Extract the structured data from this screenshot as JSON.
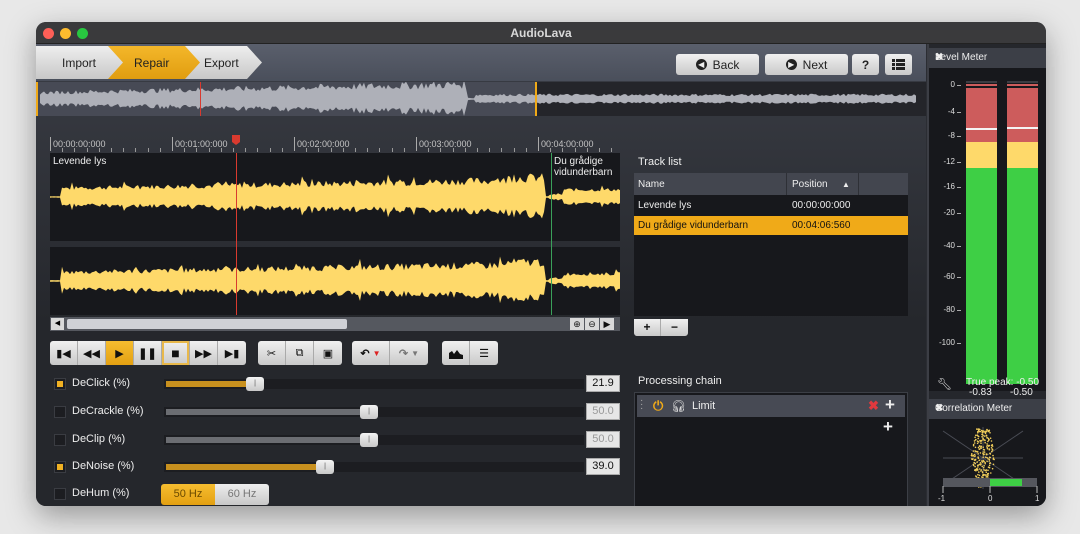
{
  "window": {
    "title": "AudioLava"
  },
  "breadcrumbs": [
    {
      "label": "Import",
      "active": false
    },
    {
      "label": "Repair",
      "active": true
    },
    {
      "label": "Export",
      "active": false
    }
  ],
  "nav": {
    "back_label": "Back",
    "next_label": "Next",
    "help_label": "?",
    "back_icon": "chevron-left-circle-icon",
    "next_icon": "chevron-right-circle-icon",
    "list_icon": "list-icon"
  },
  "timeline": {
    "ticks": [
      "00:00:00:000",
      "00:01:00:000",
      "00:02:00:000",
      "00:03:00:000",
      "00:04:00:000"
    ]
  },
  "tracks": {
    "track1_label": "Levende lys",
    "track2_label": "Du grådige vidunderbarn"
  },
  "transport": {
    "buttons": [
      {
        "name": "skip-to-start",
        "glyph": "⏮"
      },
      {
        "name": "rewind",
        "glyph": "⏪"
      },
      {
        "name": "play",
        "glyph": "▶",
        "active": true
      },
      {
        "name": "pause",
        "glyph": "⏸"
      },
      {
        "name": "stop",
        "glyph": "■"
      },
      {
        "name": "fast-forward",
        "glyph": "⏩"
      },
      {
        "name": "skip-to-end",
        "glyph": "⏭"
      }
    ],
    "edit": [
      "cut",
      "copy",
      "paste"
    ],
    "history": [
      "undo",
      "redo"
    ],
    "view": [
      "spectrum",
      "list"
    ]
  },
  "filters": [
    {
      "label": "DeClick (%)",
      "enabled": true,
      "value": "21.9",
      "level": 21.9
    },
    {
      "label": "DeCrackle (%)",
      "enabled": false,
      "value": "50.0",
      "level": 50.0
    },
    {
      "label": "DeClip (%)",
      "enabled": false,
      "value": "50.0",
      "level": 50.0
    },
    {
      "label": "DeNoise (%)",
      "enabled": true,
      "value": "39.0",
      "level": 39.0
    },
    {
      "label": "DeHum (%)",
      "enabled": false,
      "options": [
        "50 Hz",
        "60 Hz"
      ],
      "selected": "50 Hz"
    }
  ],
  "tracklist": {
    "title": "Track list",
    "columns": [
      "Name",
      "Position"
    ],
    "sort_indicator": "▲",
    "rows": [
      {
        "name": "Levende lys",
        "position": "00:00:00:000",
        "selected": false
      },
      {
        "name": "Du grådige vidunderbarn",
        "position": "00:04:06:560",
        "selected": true
      }
    ],
    "add_label": "+",
    "remove_label": "−"
  },
  "processing_chain": {
    "title": "Processing chain",
    "items": [
      {
        "label": "Limit",
        "enabled": true
      }
    ]
  },
  "level_meter": {
    "title": "Level Meter",
    "scale": [
      "0",
      "-4",
      "-8",
      "-12",
      "-16",
      "-20",
      "-40",
      "-60",
      "-80",
      "-100"
    ],
    "left_value": "-0.83",
    "right_value": "-0.50",
    "true_peak_label": "True peak: -0.50",
    "colors": {
      "red": "#cd5c5c",
      "yellow": "#fed96a",
      "green": "#3ecf45"
    }
  },
  "correlation_meter": {
    "title": "Correlation Meter",
    "scale": [
      "-1",
      "0",
      "1"
    ],
    "value_range": [
      0,
      0.7
    ]
  },
  "colors": {
    "accent": "#f0aa18",
    "waveform": "#fed96a",
    "playhead": "#d93a2f",
    "track_marker": "#3aa05a"
  }
}
